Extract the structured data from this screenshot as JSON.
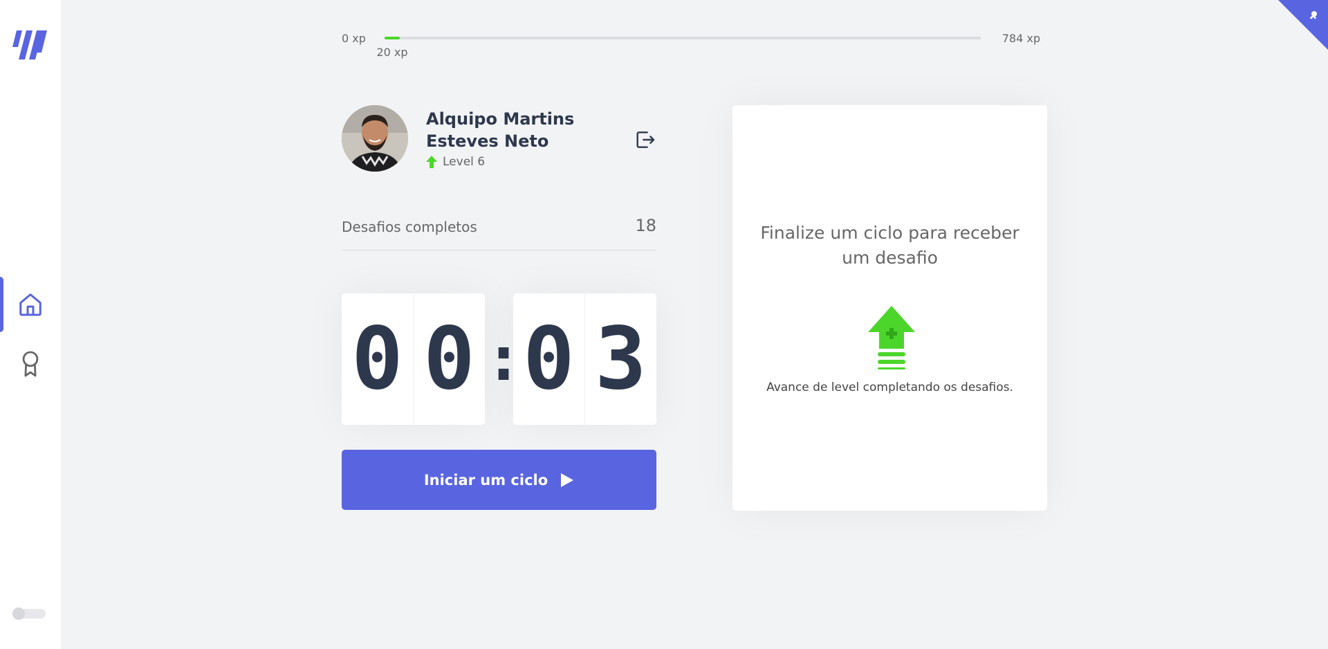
{
  "sidebar": {
    "logo_icon": "moveit-logo-icon",
    "nav": [
      {
        "name": "home",
        "icon": "home-icon",
        "active": true
      },
      {
        "name": "leaderboard",
        "icon": "award-icon",
        "active": false
      }
    ],
    "theme_toggle_on": false
  },
  "xp": {
    "start_label": "0 xp",
    "end_label": "784 xp",
    "current_label": "20 xp",
    "current_value": 20,
    "max_value": 784
  },
  "profile": {
    "name": "Alquipo Martins Esteves Neto",
    "level_label": "Level 6",
    "level_icon": "level-up-arrow-icon",
    "logout_icon": "logout-icon"
  },
  "challenges": {
    "label": "Desafios completos",
    "count": "18"
  },
  "countdown": {
    "minute_left": "0",
    "minute_right": "0",
    "separator": ":",
    "second_left": "0",
    "second_right": "3"
  },
  "start_button": {
    "label": "Iniciar um ciclo",
    "icon": "play-icon"
  },
  "challenge_box": {
    "title": "Finalize um ciclo para receber um desafio",
    "icon": "level-up-icon",
    "text": "Avance de level completando os desafios."
  },
  "colors": {
    "accent": "#5965e0",
    "green": "#4cd62b",
    "text": "#666666",
    "title": "#2e384d",
    "background": "#f2f3f5"
  }
}
